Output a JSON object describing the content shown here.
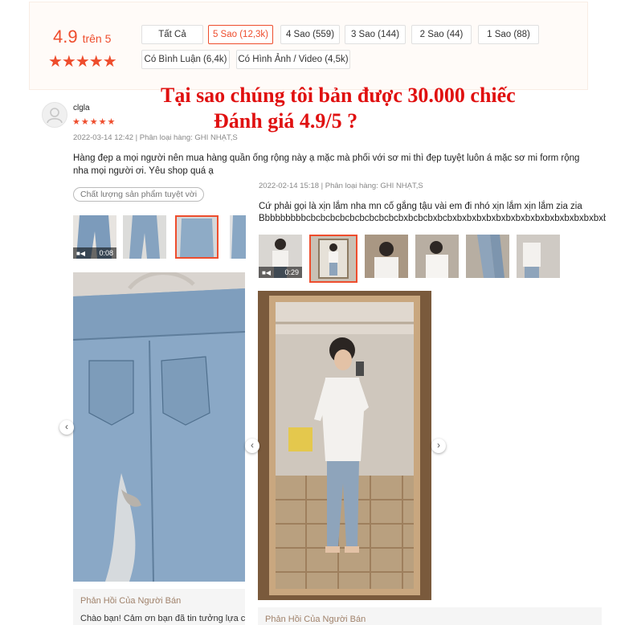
{
  "summary": {
    "rating_value": "4.9",
    "rating_suffix": "trên 5",
    "stars": "★★★★★",
    "filters": [
      {
        "label": "Tất Cả",
        "active": false
      },
      {
        "label": "5 Sao (12,3k)",
        "active": true
      },
      {
        "label": "4 Sao (559)",
        "active": false
      },
      {
        "label": "3 Sao (144)",
        "active": false
      },
      {
        "label": "2 Sao (44)",
        "active": false
      },
      {
        "label": "1 Sao (88)",
        "active": false
      },
      {
        "label": "Có Bình Luận (6,4k)",
        "active": false
      },
      {
        "label": "Có Hình Ảnh / Video (4,5k)",
        "active": false
      }
    ]
  },
  "headline": {
    "line1": "Tại sao chúng tôi bản được 30.000 chiếc",
    "line2": "Đánh giá 4.9/5 ?"
  },
  "review1": {
    "username": "clgla",
    "stars": "★★★★★",
    "meta": "2022-03-14 12:42 | Phân loại hàng: GHI NHẠT,S",
    "text": "Hàng đẹp a mọi người nên mua hàng quần ống rộng này ạ mặc mà phối với sơ mi thì đẹp tuyệt luôn á mặc sơ mi form rộng nha mọi người ơi. Yêu shop quá ạ",
    "tag": "Chất lượng sản phẩm tuyệt vời",
    "video_duration": "0:08",
    "reply_title": "Phản Hồi Của Người Bán",
    "reply_text": "Chào bạn! Cảm ơn bạn đã tin tưởng lựa chọn"
  },
  "review2": {
    "meta": "2022-02-14 15:18 | Phân loại hàng: GHI NHẠT,S",
    "text_line1": "Cứ phải gọi là xịn lắm nha mn cố gắng tậu vài em đi nhó xịn lắm xịn lắm zia zia",
    "text_line2": "Bbbbbbbbbcbcbcbcbcbcbcbcbcbcbxbcbcbxbcbxbxbxbxbxbxbxbxbxbxbxbxbxbxbxbxbxbxb",
    "video_duration": "0:29",
    "reply_title": "Phản Hồi Của Người Bán"
  },
  "icons": {
    "prev": "‹",
    "next": "›",
    "video": "video-camera-icon"
  },
  "colors": {
    "accent": "#ee4d2d",
    "headline": "#e01010",
    "reply_title": "#a0826b"
  }
}
